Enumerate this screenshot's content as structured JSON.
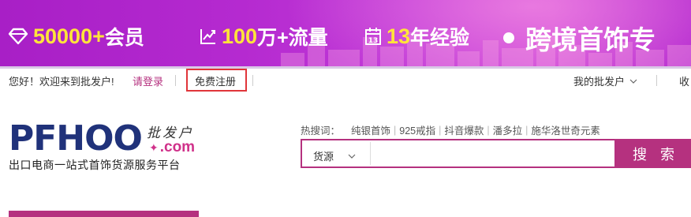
{
  "colors": {
    "brand": "#b5317f",
    "logo_blue": "#20327a",
    "banner_purple": "#b52ad0",
    "banner_yellow": "#ffe43a",
    "highlight_border": "#e0353a"
  },
  "banner": {
    "item1": {
      "icon": "diamond-icon",
      "num": "50000+",
      "text": "会员"
    },
    "item2": {
      "icon": "trend-chart-icon",
      "num": "100",
      "text": "万+流量"
    },
    "item3": {
      "icon": "calendar-icon",
      "num": "13",
      "text": "年经验"
    },
    "headline": "跨境首饰专"
  },
  "topbar": {
    "welcome": "您好！欢迎来到批发户!",
    "login": "请登录",
    "register": "免费注册",
    "my_account": "我的批发户",
    "favorite": "收"
  },
  "logo": {
    "brand": "PFHOO",
    "cn_name": "批发户",
    "domain": ".com",
    "slogan": "出口电商一站式首饰货源服务平台"
  },
  "hot_search": {
    "label": "热搜词：",
    "items": [
      "纯银首饰",
      "925戒指",
      "抖音爆款",
      "潘多拉",
      "施华洛世奇元素"
    ]
  },
  "search": {
    "category": "货源",
    "value": "",
    "button": "搜 索"
  }
}
